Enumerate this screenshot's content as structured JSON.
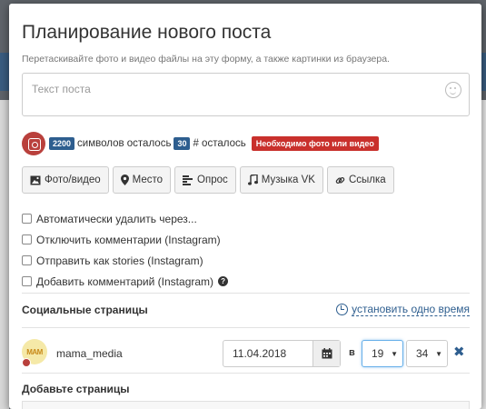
{
  "modal": {
    "title": "Планирование нового поста",
    "hint": "Перетаскивайте фото и видео файлы на эту форму, а также картинки из браузера."
  },
  "post": {
    "placeholder": "Текст поста"
  },
  "counters": {
    "symbols_count": "2200",
    "symbols_label": "символов осталось",
    "hashtags_count": "30",
    "hashtags_label": "# осталось",
    "warning": "Необходимо фото или видео"
  },
  "attach_buttons": {
    "photo_video": "Фото/видео",
    "place": "Место",
    "poll": "Опрос",
    "music": "Музыка VK",
    "link": "Ссылка"
  },
  "options": {
    "auto_delete": "Автоматически удалить через...",
    "disable_comments": "Отключить комментарии (Instagram)",
    "send_as_stories": "Отправить как stories (Instagram)",
    "add_comment": "Добавить комментарий (Instagram)"
  },
  "social": {
    "title": "Социальные страницы",
    "set_one_time": "установить одно время",
    "page": {
      "avatar_text": "MAM",
      "name": "mama_media",
      "date": "11.04.2018",
      "at_label": "в",
      "hour": "19",
      "minute": "34"
    }
  },
  "add_pages": {
    "title": "Добавьте страницы"
  },
  "colors": {
    "primary": "#2e5e8f",
    "danger": "#c9302c",
    "instagram": "#b9403c"
  }
}
